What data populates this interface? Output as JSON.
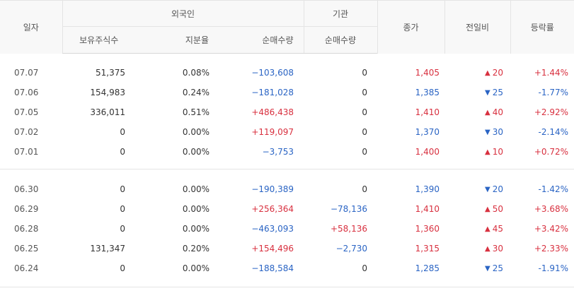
{
  "header": {
    "date": "일자",
    "foreign": "외국인",
    "institution": "기관",
    "close": "종가",
    "diff": "전일비",
    "rate": "등락률",
    "holdings": "보유주식수",
    "ratio": "지분율",
    "foreign_net": "순매수량",
    "inst_net": "순매수량"
  },
  "colors": {
    "up": "#d8303f",
    "down": "#2a64c4"
  },
  "groups": [
    {
      "rows": [
        {
          "date": "07.07",
          "holdings": "51,375",
          "ratio": "0.08%",
          "foreign_net": "−103,608",
          "foreign_dir": "down",
          "inst_net": "0",
          "inst_dir": "none",
          "close": "1,405",
          "close_dir": "up",
          "diff_arrow": "▲",
          "diff": "20",
          "diff_dir": "up",
          "rate": "+1.44%",
          "rate_dir": "up"
        },
        {
          "date": "07.06",
          "holdings": "154,983",
          "ratio": "0.24%",
          "foreign_net": "−181,028",
          "foreign_dir": "down",
          "inst_net": "0",
          "inst_dir": "none",
          "close": "1,385",
          "close_dir": "down",
          "diff_arrow": "▼",
          "diff": "25",
          "diff_dir": "down",
          "rate": "-1.77%",
          "rate_dir": "down"
        },
        {
          "date": "07.05",
          "holdings": "336,011",
          "ratio": "0.51%",
          "foreign_net": "+486,438",
          "foreign_dir": "up",
          "inst_net": "0",
          "inst_dir": "none",
          "close": "1,410",
          "close_dir": "up",
          "diff_arrow": "▲",
          "diff": "40",
          "diff_dir": "up",
          "rate": "+2.92%",
          "rate_dir": "up"
        },
        {
          "date": "07.02",
          "holdings": "0",
          "ratio": "0.00%",
          "foreign_net": "+119,097",
          "foreign_dir": "up",
          "inst_net": "0",
          "inst_dir": "none",
          "close": "1,370",
          "close_dir": "down",
          "diff_arrow": "▼",
          "diff": "30",
          "diff_dir": "down",
          "rate": "-2.14%",
          "rate_dir": "down"
        },
        {
          "date": "07.01",
          "holdings": "0",
          "ratio": "0.00%",
          "foreign_net": "−3,753",
          "foreign_dir": "down",
          "inst_net": "0",
          "inst_dir": "none",
          "close": "1,400",
          "close_dir": "up",
          "diff_arrow": "▲",
          "diff": "10",
          "diff_dir": "up",
          "rate": "+0.72%",
          "rate_dir": "up"
        }
      ]
    },
    {
      "rows": [
        {
          "date": "06.30",
          "holdings": "0",
          "ratio": "0.00%",
          "foreign_net": "−190,389",
          "foreign_dir": "down",
          "inst_net": "0",
          "inst_dir": "none",
          "close": "1,390",
          "close_dir": "down",
          "diff_arrow": "▼",
          "diff": "20",
          "diff_dir": "down",
          "rate": "-1.42%",
          "rate_dir": "down"
        },
        {
          "date": "06.29",
          "holdings": "0",
          "ratio": "0.00%",
          "foreign_net": "+256,364",
          "foreign_dir": "up",
          "inst_net": "−78,136",
          "inst_dir": "down",
          "close": "1,410",
          "close_dir": "up",
          "diff_arrow": "▲",
          "diff": "50",
          "diff_dir": "up",
          "rate": "+3.68%",
          "rate_dir": "up"
        },
        {
          "date": "06.28",
          "holdings": "0",
          "ratio": "0.00%",
          "foreign_net": "−463,093",
          "foreign_dir": "down",
          "inst_net": "+58,136",
          "inst_dir": "up",
          "close": "1,360",
          "close_dir": "up",
          "diff_arrow": "▲",
          "diff": "45",
          "diff_dir": "up",
          "rate": "+3.42%",
          "rate_dir": "up"
        },
        {
          "date": "06.25",
          "holdings": "131,347",
          "ratio": "0.20%",
          "foreign_net": "+154,496",
          "foreign_dir": "up",
          "inst_net": "−2,730",
          "inst_dir": "down",
          "close": "1,315",
          "close_dir": "up",
          "diff_arrow": "▲",
          "diff": "30",
          "diff_dir": "up",
          "rate": "+2.33%",
          "rate_dir": "up"
        },
        {
          "date": "06.24",
          "holdings": "0",
          "ratio": "0.00%",
          "foreign_net": "−188,584",
          "foreign_dir": "down",
          "inst_net": "0",
          "inst_dir": "none",
          "close": "1,285",
          "close_dir": "down",
          "diff_arrow": "▼",
          "diff": "25",
          "diff_dir": "down",
          "rate": "-1.91%",
          "rate_dir": "down"
        }
      ]
    }
  ]
}
